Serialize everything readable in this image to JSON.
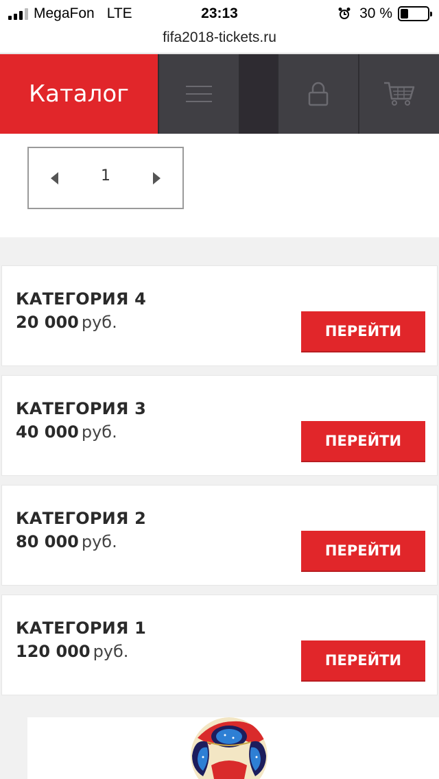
{
  "status": {
    "carrier": "MegaFon",
    "network": "LTE",
    "time": "23:13",
    "battery": "30 %",
    "battery_level": 0.3
  },
  "browser": {
    "url": "fifa2018-tickets.ru"
  },
  "nav": {
    "catalog_label": "Каталог",
    "icons": [
      "menu-icon",
      "lock-icon",
      "cart-icon"
    ],
    "accent": "#e1262a",
    "dark_bg": "#403f44"
  },
  "pager": {
    "current": "1"
  },
  "categories": [
    {
      "title": "КАТЕГОРИЯ 4",
      "amount": "20 000",
      "currency": "руб.",
      "button": "ПЕРЕЙТИ"
    },
    {
      "title": "КАТЕГОРИЯ 3",
      "amount": "40 000",
      "currency": "руб.",
      "button": "ПЕРЕЙТИ"
    },
    {
      "title": "КАТЕГОРИЯ 2",
      "amount": "80 000",
      "currency": "руб.",
      "button": "ПЕРЕЙТИ"
    },
    {
      "title": "КАТЕГОРИЯ 1",
      "amount": "120 000",
      "currency": "руб.",
      "button": "ПЕРЕЙТИ"
    }
  ]
}
